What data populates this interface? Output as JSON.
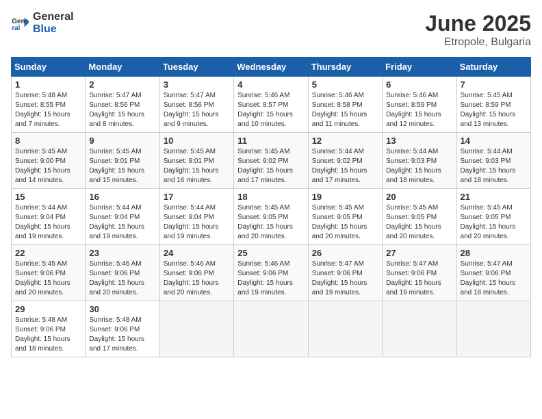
{
  "logo": {
    "general": "General",
    "blue": "Blue"
  },
  "title": {
    "month": "June 2025",
    "location": "Etropole, Bulgaria"
  },
  "headers": [
    "Sunday",
    "Monday",
    "Tuesday",
    "Wednesday",
    "Thursday",
    "Friday",
    "Saturday"
  ],
  "weeks": [
    [
      {
        "day": "1",
        "sunrise": "Sunrise: 5:48 AM",
        "sunset": "Sunset: 8:55 PM",
        "daylight": "Daylight: 15 hours and 7 minutes."
      },
      {
        "day": "2",
        "sunrise": "Sunrise: 5:47 AM",
        "sunset": "Sunset: 8:56 PM",
        "daylight": "Daylight: 15 hours and 8 minutes."
      },
      {
        "day": "3",
        "sunrise": "Sunrise: 5:47 AM",
        "sunset": "Sunset: 8:56 PM",
        "daylight": "Daylight: 15 hours and 9 minutes."
      },
      {
        "day": "4",
        "sunrise": "Sunrise: 5:46 AM",
        "sunset": "Sunset: 8:57 PM",
        "daylight": "Daylight: 15 hours and 10 minutes."
      },
      {
        "day": "5",
        "sunrise": "Sunrise: 5:46 AM",
        "sunset": "Sunset: 8:58 PM",
        "daylight": "Daylight: 15 hours and 11 minutes."
      },
      {
        "day": "6",
        "sunrise": "Sunrise: 5:46 AM",
        "sunset": "Sunset: 8:59 PM",
        "daylight": "Daylight: 15 hours and 12 minutes."
      },
      {
        "day": "7",
        "sunrise": "Sunrise: 5:45 AM",
        "sunset": "Sunset: 8:59 PM",
        "daylight": "Daylight: 15 hours and 13 minutes."
      }
    ],
    [
      {
        "day": "8",
        "sunrise": "Sunrise: 5:45 AM",
        "sunset": "Sunset: 9:00 PM",
        "daylight": "Daylight: 15 hours and 14 minutes."
      },
      {
        "day": "9",
        "sunrise": "Sunrise: 5:45 AM",
        "sunset": "Sunset: 9:01 PM",
        "daylight": "Daylight: 15 hours and 15 minutes."
      },
      {
        "day": "10",
        "sunrise": "Sunrise: 5:45 AM",
        "sunset": "Sunset: 9:01 PM",
        "daylight": "Daylight: 15 hours and 16 minutes."
      },
      {
        "day": "11",
        "sunrise": "Sunrise: 5:45 AM",
        "sunset": "Sunset: 9:02 PM",
        "daylight": "Daylight: 15 hours and 17 minutes."
      },
      {
        "day": "12",
        "sunrise": "Sunrise: 5:44 AM",
        "sunset": "Sunset: 9:02 PM",
        "daylight": "Daylight: 15 hours and 17 minutes."
      },
      {
        "day": "13",
        "sunrise": "Sunrise: 5:44 AM",
        "sunset": "Sunset: 9:03 PM",
        "daylight": "Daylight: 15 hours and 18 minutes."
      },
      {
        "day": "14",
        "sunrise": "Sunrise: 5:44 AM",
        "sunset": "Sunset: 9:03 PM",
        "daylight": "Daylight: 15 hours and 18 minutes."
      }
    ],
    [
      {
        "day": "15",
        "sunrise": "Sunrise: 5:44 AM",
        "sunset": "Sunset: 9:04 PM",
        "daylight": "Daylight: 15 hours and 19 minutes."
      },
      {
        "day": "16",
        "sunrise": "Sunrise: 5:44 AM",
        "sunset": "Sunset: 9:04 PM",
        "daylight": "Daylight: 15 hours and 19 minutes."
      },
      {
        "day": "17",
        "sunrise": "Sunrise: 5:44 AM",
        "sunset": "Sunset: 9:04 PM",
        "daylight": "Daylight: 15 hours and 19 minutes."
      },
      {
        "day": "18",
        "sunrise": "Sunrise: 5:45 AM",
        "sunset": "Sunset: 9:05 PM",
        "daylight": "Daylight: 15 hours and 20 minutes."
      },
      {
        "day": "19",
        "sunrise": "Sunrise: 5:45 AM",
        "sunset": "Sunset: 9:05 PM",
        "daylight": "Daylight: 15 hours and 20 minutes."
      },
      {
        "day": "20",
        "sunrise": "Sunrise: 5:45 AM",
        "sunset": "Sunset: 9:05 PM",
        "daylight": "Daylight: 15 hours and 20 minutes."
      },
      {
        "day": "21",
        "sunrise": "Sunrise: 5:45 AM",
        "sunset": "Sunset: 9:05 PM",
        "daylight": "Daylight: 15 hours and 20 minutes."
      }
    ],
    [
      {
        "day": "22",
        "sunrise": "Sunrise: 5:45 AM",
        "sunset": "Sunset: 9:06 PM",
        "daylight": "Daylight: 15 hours and 20 minutes."
      },
      {
        "day": "23",
        "sunrise": "Sunrise: 5:46 AM",
        "sunset": "Sunset: 9:06 PM",
        "daylight": "Daylight: 15 hours and 20 minutes."
      },
      {
        "day": "24",
        "sunrise": "Sunrise: 5:46 AM",
        "sunset": "Sunset: 9:06 PM",
        "daylight": "Daylight: 15 hours and 20 minutes."
      },
      {
        "day": "25",
        "sunrise": "Sunrise: 5:46 AM",
        "sunset": "Sunset: 9:06 PM",
        "daylight": "Daylight: 15 hours and 19 minutes."
      },
      {
        "day": "26",
        "sunrise": "Sunrise: 5:47 AM",
        "sunset": "Sunset: 9:06 PM",
        "daylight": "Daylight: 15 hours and 19 minutes."
      },
      {
        "day": "27",
        "sunrise": "Sunrise: 5:47 AM",
        "sunset": "Sunset: 9:06 PM",
        "daylight": "Daylight: 15 hours and 19 minutes."
      },
      {
        "day": "28",
        "sunrise": "Sunrise: 5:47 AM",
        "sunset": "Sunset: 9:06 PM",
        "daylight": "Daylight: 15 hours and 18 minutes."
      }
    ],
    [
      {
        "day": "29",
        "sunrise": "Sunrise: 5:48 AM",
        "sunset": "Sunset: 9:06 PM",
        "daylight": "Daylight: 15 hours and 18 minutes."
      },
      {
        "day": "30",
        "sunrise": "Sunrise: 5:48 AM",
        "sunset": "Sunset: 9:06 PM",
        "daylight": "Daylight: 15 hours and 17 minutes."
      },
      null,
      null,
      null,
      null,
      null
    ]
  ]
}
